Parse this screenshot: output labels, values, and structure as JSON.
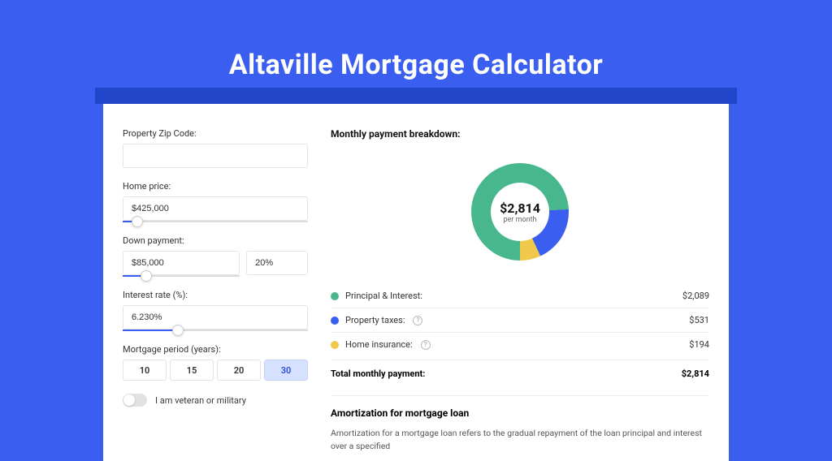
{
  "title": "Altaville Mortgage Calculator",
  "form": {
    "zip": {
      "label": "Property Zip Code:",
      "value": ""
    },
    "home_price": {
      "label": "Home price:",
      "value": "$425,000",
      "slider_pct": 8
    },
    "down_payment": {
      "label": "Down payment:",
      "amount": "$85,000",
      "pct": "20%",
      "slider_pct": 20
    },
    "interest_rate": {
      "label": "Interest rate (%):",
      "value": "6.230%",
      "slider_pct": 30
    },
    "period": {
      "label": "Mortgage period (years):",
      "options": [
        "10",
        "15",
        "20",
        "30"
      ],
      "active": "30"
    },
    "veteran_label": "I am veteran or military",
    "veteran": false
  },
  "breakdown": {
    "heading": "Monthly payment breakdown:",
    "center_value": "$2,814",
    "center_sub": "per month",
    "items": [
      {
        "label": "Principal & Interest:",
        "value": "$2,089",
        "color": "#49b78d",
        "info": false,
        "name": "principal-interest"
      },
      {
        "label": "Property taxes:",
        "value": "$531",
        "color": "#3a5ef0",
        "info": true,
        "name": "property-taxes"
      },
      {
        "label": "Home insurance:",
        "value": "$194",
        "color": "#f0c94a",
        "info": true,
        "name": "home-insurance"
      }
    ],
    "total_label": "Total monthly payment:",
    "total_value": "$2,814"
  },
  "chart_data": {
    "type": "pie",
    "title": "Monthly payment breakdown",
    "series": [
      {
        "name": "Principal & Interest",
        "value": 2089,
        "color": "#49b78d"
      },
      {
        "name": "Property taxes",
        "value": 531,
        "color": "#3a5ef0"
      },
      {
        "name": "Home insurance",
        "value": 194,
        "color": "#f0c94a"
      }
    ],
    "total": 2814,
    "center_label": "$2,814 per month"
  },
  "amortization": {
    "heading": "Amortization for mortgage loan",
    "text": "Amortization for a mortgage loan refers to the gradual repayment of the loan principal and interest over a specified"
  }
}
